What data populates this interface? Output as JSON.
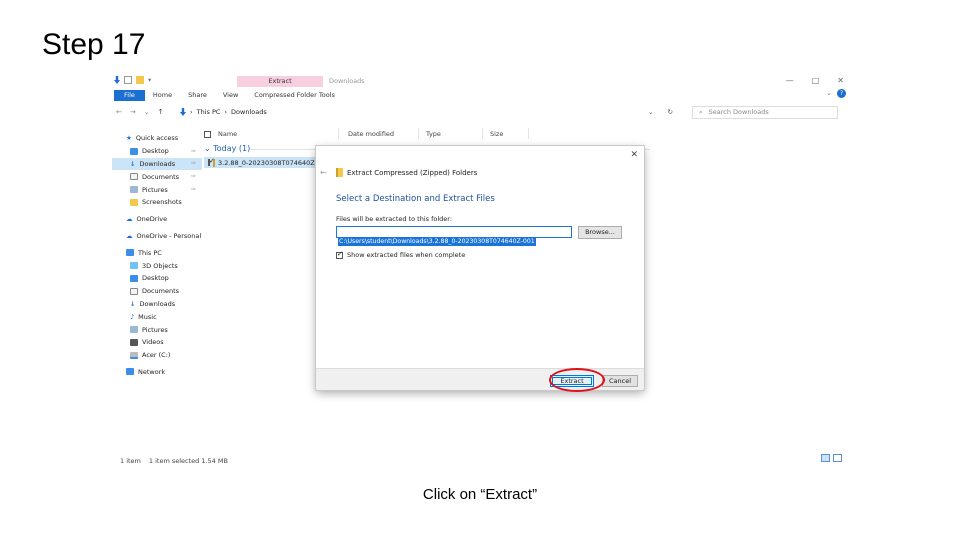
{
  "slide": {
    "step_title": "Step 17",
    "caption": "Click on “Extract”"
  },
  "explorer": {
    "context_tab": "Extract",
    "window_title": "Downloads",
    "ribbon_tabs": [
      "File",
      "Home",
      "Share",
      "View",
      "Compressed Folder Tools"
    ],
    "window_controls": [
      "—",
      "□",
      "✕"
    ],
    "breadcrumb": [
      "This PC",
      "Downloads"
    ],
    "search_placeholder": "Search Downloads",
    "columns": [
      "Name",
      "Date modified",
      "Type",
      "Size"
    ],
    "group_label": "Today (1)",
    "file_name": "3.2.88_0-20230308T074640Z-001",
    "sidebar": {
      "quick_access": "Quick access",
      "desktop": "Desktop",
      "downloads": "Downloads",
      "documents": "Documents",
      "pictures": "Pictures",
      "screenshots": "Screenshots",
      "onedrive": "OneDrive",
      "onedrive_personal": "OneDrive - Personal",
      "this_pc": "This PC",
      "objects3d": "3D Objects",
      "pc_desktop": "Desktop",
      "pc_documents": "Documents",
      "pc_downloads": "Downloads",
      "music": "Music",
      "pc_pictures": "Pictures",
      "videos": "Videos",
      "acer": "Acer (C:)",
      "network": "Network"
    },
    "status": {
      "count": "1 item",
      "selected": "1 item selected  1.54 MB"
    }
  },
  "dialog": {
    "title": "Extract Compressed (Zipped) Folders",
    "heading": "Select a Destination and Extract Files",
    "label": "Files will be extracted to this folder:",
    "path": "C:\\Users\\student\\Downloads\\3.2.88_0-20230308T074640Z-001",
    "browse": "Browse...",
    "checkbox_label": "Show extracted files when complete",
    "checkbox_checked": true,
    "extract": "Extract",
    "cancel": "Cancel"
  },
  "colors": {
    "accent_blue": "#1a6fd1",
    "highlight_ring": "#e0101a",
    "context_tab": "#f7cfe1"
  }
}
